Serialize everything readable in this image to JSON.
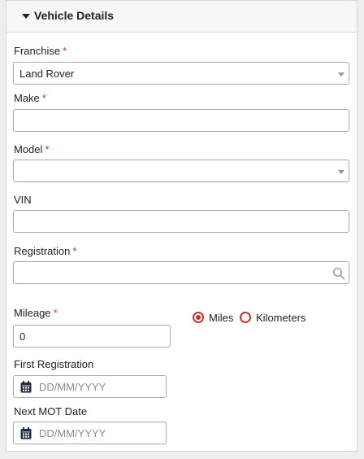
{
  "section": {
    "title": "Vehicle Details",
    "icon": "caret-down-icon"
  },
  "required_marker": "*",
  "fields": {
    "franchise": {
      "label": "Franchise",
      "value": "Land Rover",
      "required": true
    },
    "make": {
      "label": "Make",
      "value": "",
      "required": true
    },
    "model": {
      "label": "Model",
      "value": "",
      "required": true
    },
    "vin": {
      "label": "VIN",
      "value": "",
      "required": false
    },
    "registration": {
      "label": "Registration",
      "value": "",
      "required": true,
      "icon": "search-icon"
    },
    "mileage": {
      "label": "Mileage",
      "value": "0",
      "required": true
    },
    "first_registration": {
      "label": "First Registration",
      "placeholder": "DD/MM/YYYY",
      "icon": "calendar-icon"
    },
    "next_mot": {
      "label": "Next MOT Date",
      "placeholder": "DD/MM/YYYY",
      "icon": "calendar-icon"
    }
  },
  "mileage_unit": {
    "options": [
      "Miles",
      "Kilometers"
    ],
    "selected": "Miles"
  },
  "colors": {
    "accent": "#d32f2f",
    "calendar_icon": "#1f2a44"
  }
}
